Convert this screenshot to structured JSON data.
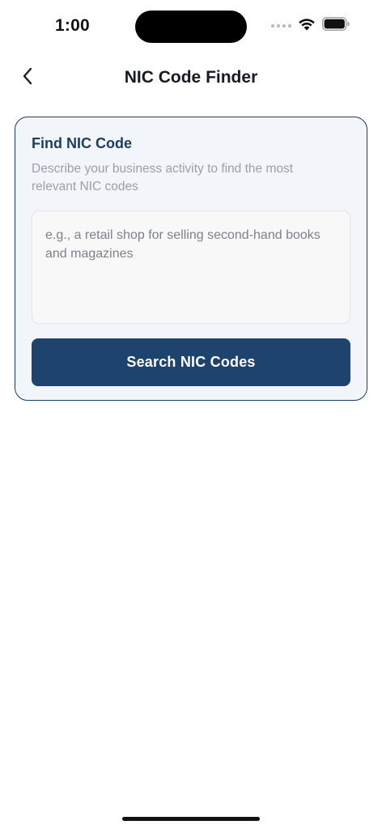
{
  "status_bar": {
    "time": "1:00",
    "icons": [
      "cellular-signal-icon",
      "wifi-icon",
      "battery-icon"
    ]
  },
  "nav": {
    "title": "NIC Code Finder",
    "back_icon": "chevron-left-icon"
  },
  "card": {
    "title": "Find NIC Code",
    "description": "Describe your business activity to find the most relevant NIC codes",
    "input_placeholder": "e.g., a retail shop for selling second-hand books and magazines",
    "input_value": "",
    "button_label": "Search NIC Codes"
  },
  "colors": {
    "accent": "#1e436c",
    "card_border": "#1e3d60",
    "card_background": "#f2f5f9",
    "title_color": "#1e3d60"
  }
}
